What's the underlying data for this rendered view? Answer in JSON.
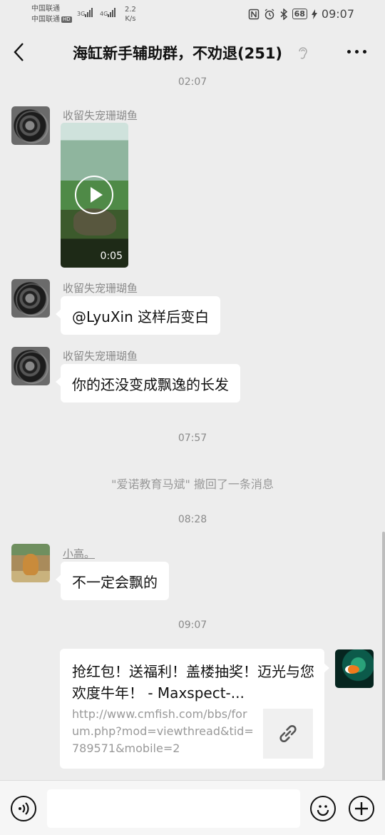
{
  "status_bar": {
    "carrier1": "中国联通",
    "carrier2": "中国联通",
    "hd": "HD",
    "signal1_label": "3G",
    "signal2_label": "4G",
    "net_speed_value": "2.2",
    "net_speed_unit": "K/s",
    "icons": [
      "nfc-icon",
      "alarm-icon",
      "bluetooth-icon",
      "charging-icon"
    ],
    "battery": "68",
    "time": "09:07"
  },
  "nav": {
    "title": "海缸新手辅助群，不劝退(251)",
    "icons": [
      "back-icon",
      "earpiece-icon",
      "more-icon"
    ]
  },
  "chat": {
    "ts1": "02:07",
    "msg1": {
      "sender": "收留失宠珊瑚鱼",
      "video_duration": "0:05"
    },
    "msg2": {
      "sender": "收留失宠珊瑚鱼",
      "text": "@LyuXin  这样后变白"
    },
    "msg3": {
      "sender": "收留失宠珊瑚鱼",
      "text": "你的还没变成飘逸的长发"
    },
    "ts2": "07:57",
    "recall_notice": "\"爱诺教育马斌\" 撤回了一条消息",
    "ts3": "08:28",
    "msg4": {
      "sender": "小高。",
      "text": "不一定会飘的"
    },
    "ts4": "09:07",
    "msg5": {
      "title": "抢红包！送福利！盖楼抽奖！迈光与您欢度牛年！ - Maxspect-...",
      "url": "http://www.cmfish.com/bbs/forum.php?mod=viewthread&tid=789571&mobile=2"
    }
  },
  "input_bar": {
    "placeholder": "",
    "icons": [
      "voice-icon",
      "emoji-icon",
      "plus-icon"
    ]
  }
}
